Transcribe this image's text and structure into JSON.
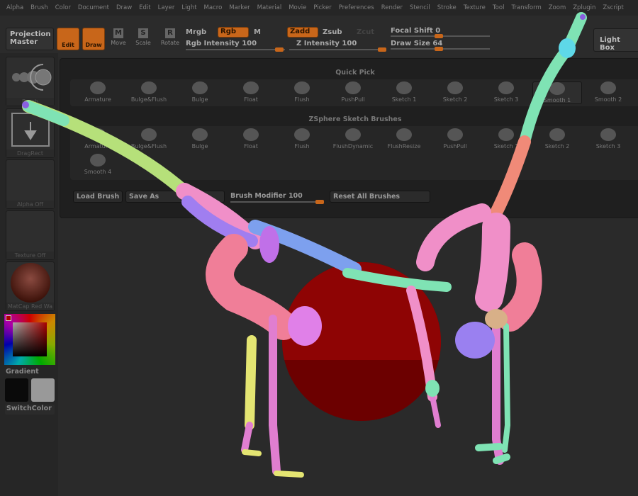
{
  "menu": [
    "Alpha",
    "Brush",
    "Color",
    "Document",
    "Draw",
    "Edit",
    "Layer",
    "Light",
    "Macro",
    "Marker",
    "Material",
    "Movie",
    "Picker",
    "Preferences",
    "Render",
    "Stencil",
    "Stroke",
    "Texture",
    "Tool",
    "Transform",
    "Zoom",
    "Zplugin",
    "Zscript"
  ],
  "toolbar": {
    "projection_master": "Projection Master",
    "edit": "Edit",
    "draw": "Draw",
    "move": "Move",
    "scale": "Scale",
    "rotate": "Rotate",
    "move_key": "M",
    "scale_key": "S",
    "rotate_key": "R",
    "mrgb": "Mrgb",
    "rgb": "Rgb",
    "m": "M",
    "zadd": "Zadd",
    "zsub": "Zsub",
    "zcut": "Zcut",
    "rgb_intensity_label": "Rgb Intensity",
    "rgb_intensity": "100",
    "z_intensity_label": "Z Intensity",
    "z_intensity": "100",
    "focal_shift_label": "Focal Shift",
    "focal_shift": "0",
    "draw_size_label": "Draw Size",
    "draw_size": "64",
    "light_box": "Light Box"
  },
  "shelf": {
    "brush": "Brush",
    "stroke": "DragRect",
    "alpha": "Alpha Off",
    "texture": "Texture Off",
    "material": "MatCap Red Wa",
    "gradient": "Gradient",
    "switch_color": "SwitchColor"
  },
  "palette": {
    "quick_pick": "Quick Pick",
    "quick_items": [
      "Armature",
      "Bulge&Flush",
      "Bulge",
      "Float",
      "Flush",
      "PushPull",
      "Sketch 1",
      "Sketch 2",
      "Sketch 3",
      "Smooth 1",
      "Smooth 2"
    ],
    "zsphere_title": "ZSphere Sketch Brushes",
    "zsphere_items": [
      "Armature",
      "Bulge&Flush",
      "Bulge",
      "Float",
      "Flush",
      "FlushDynamic",
      "FlushResize",
      "PushPull",
      "Sketch 1",
      "Sketch 2",
      "Sketch 3",
      "Smooth 4"
    ],
    "load_brush": "Load Brush",
    "save_as": "Save As",
    "brush_modifier_label": "Brush Modifier",
    "brush_modifier": "100",
    "reset_all": "Reset All Brushes"
  },
  "colors": {
    "accent": "#c8661a",
    "sphere": "#8a0000"
  }
}
